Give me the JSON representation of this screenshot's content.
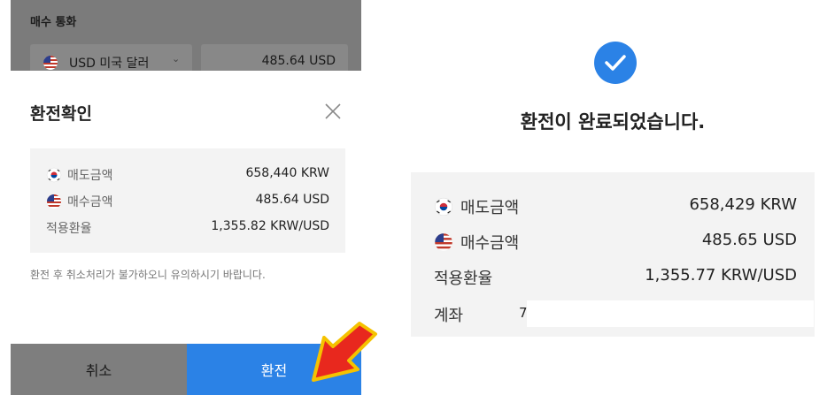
{
  "left": {
    "section_label": "매수 통화",
    "currency_select": "USD 미국 달러",
    "amount": "485.64 USD",
    "modal_title": "환전확인",
    "rows": [
      {
        "flag": "kr-flag-icon",
        "label": "매도금액",
        "value": "658,440 KRW"
      },
      {
        "flag": "us-flag-icon",
        "label": "매수금액",
        "value": "485.64 USD"
      },
      {
        "label": "적용환율",
        "value": "1,355.82 KRW/USD"
      }
    ],
    "notice": "환전 후 취소처리가 불가하오니 유의하시기 바랍니다.",
    "cancel_label": "취소",
    "confirm_label": "환전"
  },
  "right": {
    "title": "환전이 완료되었습니다.",
    "rows": [
      {
        "flag": "kr-flag-icon",
        "label": "매도금액",
        "value": "658,429 KRW"
      },
      {
        "flag": "us-flag-icon",
        "label": "매수금액",
        "value": "485.65 USD"
      },
      {
        "label": "적용환율",
        "value": "1,355.77 KRW/USD"
      }
    ],
    "account_label": "계좌",
    "account_value": "7"
  },
  "colors": {
    "accent": "#2b82e6",
    "arrow_fill": "#e8281e",
    "arrow_outline": "#f5c200"
  }
}
